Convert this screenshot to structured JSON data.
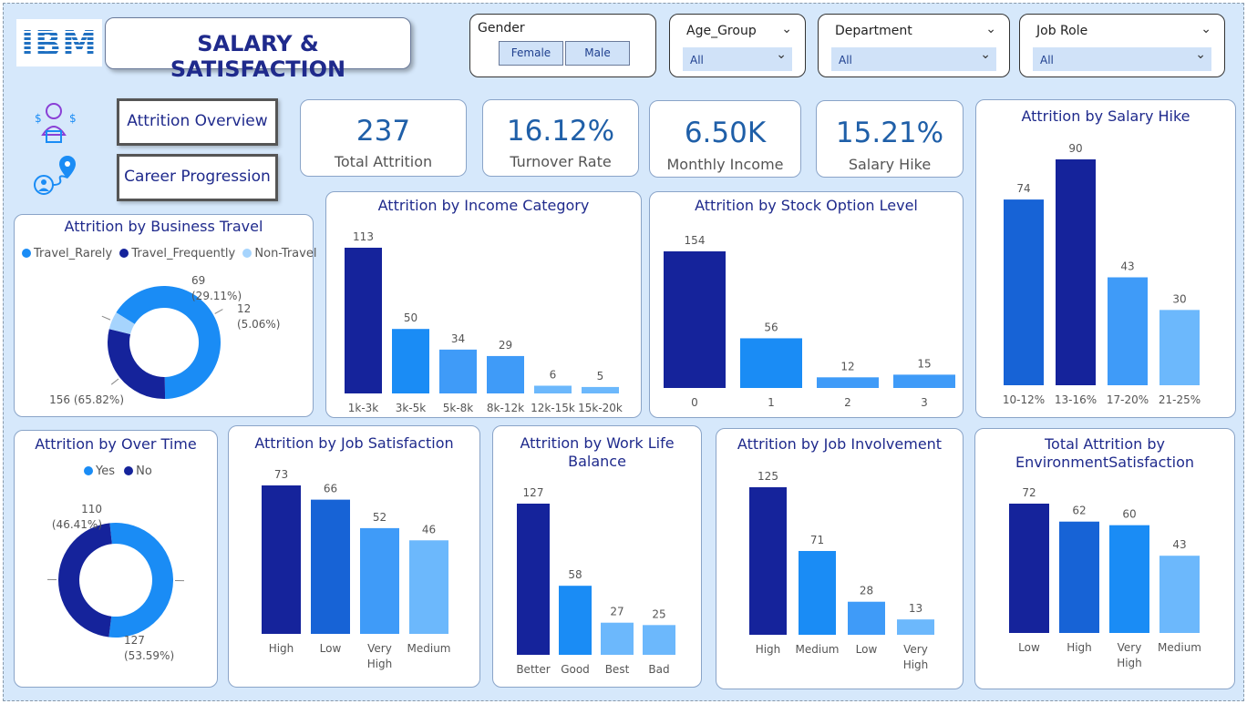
{
  "header": {
    "logo_text": "IBM",
    "title": "SALARY & SATISFACTION"
  },
  "filters": {
    "gender": {
      "label": "Gender",
      "options": [
        "Female",
        "Male"
      ]
    },
    "age_group": {
      "label": "Age_Group",
      "value": "All"
    },
    "department": {
      "label": "Department",
      "value": "All"
    },
    "job_role": {
      "label": "Job Role",
      "value": "All"
    }
  },
  "nav": {
    "overview_label": "Attrition Overview",
    "career_label": "Career Progression"
  },
  "kpis": [
    {
      "value": "237",
      "label": "Total Attrition"
    },
    {
      "value": "16.12%",
      "label": "Turnover Rate"
    },
    {
      "value": "6.50K",
      "label": "Monthly Income"
    },
    {
      "value": "15.21%",
      "label": "Salary Hike"
    }
  ],
  "colors": {
    "navy": "#15239b",
    "royal": "#1763d6",
    "blue": "#1a8cf5",
    "mid": "#3f9bf8",
    "light": "#6cb8fc",
    "pale": "#a6d4fd"
  },
  "chart_data": [
    {
      "id": "business-travel",
      "type": "pie",
      "title": "Attrition by Business Travel",
      "legend": "top-left",
      "slices": [
        {
          "name": "Travel_Rarely",
          "value": 156,
          "label": "156 (65.82%)",
          "color": "#1a8cf5"
        },
        {
          "name": "Travel_Frequently",
          "value": 69,
          "label": "69 (29.11%)",
          "color": "#15239b"
        },
        {
          "name": "Non-Travel",
          "value": 12,
          "label": "12 (5.06%)",
          "color": "#a6d4fd"
        }
      ]
    },
    {
      "id": "over-time",
      "type": "pie",
      "title": "Attrition by Over Time",
      "legend": "top-center",
      "slices": [
        {
          "name": "Yes",
          "value": 127,
          "label": "127 (53.59%)",
          "color": "#1a8cf5"
        },
        {
          "name": "No",
          "value": 110,
          "label": "110 (46.41%)",
          "color": "#15239b"
        }
      ]
    },
    {
      "id": "income-category",
      "type": "bar",
      "title": "Attrition by Income Category",
      "categories": [
        "1k-3k",
        "3k-5k",
        "5k-8k",
        "8k-12k",
        "12k-15k",
        "15k-20k"
      ],
      "values": [
        113,
        50,
        34,
        29,
        6,
        5
      ],
      "colors": [
        "#15239b",
        "#1a8cf5",
        "#3f9bf8",
        "#3f9bf8",
        "#6cb8fc",
        "#6cb8fc"
      ]
    },
    {
      "id": "stock-option",
      "type": "bar",
      "title": "Attrition by Stock Option Level",
      "categories": [
        "0",
        "1",
        "2",
        "3"
      ],
      "values": [
        154,
        56,
        12,
        15
      ],
      "colors": [
        "#15239b",
        "#1a8cf5",
        "#3f9bf8",
        "#3f9bf8"
      ]
    },
    {
      "id": "salary-hike",
      "type": "bar",
      "title": "Attrition by Salary Hike",
      "categories": [
        "10-12%",
        "13-16%",
        "17-20%",
        "21-25%"
      ],
      "values": [
        74,
        90,
        43,
        30
      ],
      "colors": [
        "#1763d6",
        "#15239b",
        "#3f9bf8",
        "#6cb8fc"
      ]
    },
    {
      "id": "job-satisfaction",
      "type": "bar",
      "title": "Attrition by Job Satisfaction",
      "categories": [
        "High",
        "Low",
        "Very High",
        "Medium"
      ],
      "values": [
        73,
        66,
        52,
        46
      ],
      "colors": [
        "#15239b",
        "#1763d6",
        "#3f9bf8",
        "#6cb8fc"
      ]
    },
    {
      "id": "work-life",
      "type": "bar",
      "title": "Attrition by Work Life Balance",
      "categories": [
        "Better",
        "Good",
        "Best",
        "Bad"
      ],
      "values": [
        127,
        58,
        27,
        25
      ],
      "colors": [
        "#15239b",
        "#1a8cf5",
        "#6cb8fc",
        "#6cb8fc"
      ]
    },
    {
      "id": "job-involvement",
      "type": "bar",
      "title": "Attrition by Job Involvement",
      "categories": [
        "High",
        "Medium",
        "Low",
        "Very High"
      ],
      "values": [
        125,
        71,
        28,
        13
      ],
      "colors": [
        "#15239b",
        "#1a8cf5",
        "#3f9bf8",
        "#6cb8fc"
      ]
    },
    {
      "id": "environment",
      "type": "bar",
      "title": "Total Attrition by EnvironmentSatisfaction",
      "categories": [
        "Low",
        "High",
        "Very High",
        "Medium"
      ],
      "values": [
        72,
        62,
        60,
        43
      ],
      "colors": [
        "#15239b",
        "#1763d6",
        "#1a8cf5",
        "#6cb8fc"
      ]
    }
  ]
}
